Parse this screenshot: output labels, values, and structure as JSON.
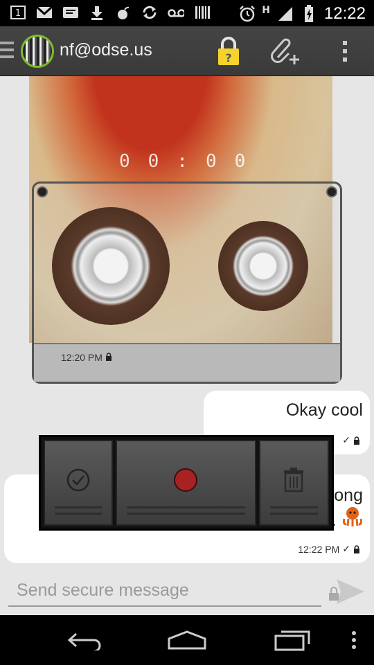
{
  "status_bar": {
    "time": "12:22",
    "network_label": "H",
    "notification_icons": [
      "sim-1-icon",
      "gmail-icon",
      "message-icon",
      "download-icon",
      "bomb-icon",
      "sync-icon",
      "voicemail-icon",
      "barcode-icon"
    ],
    "sim_label": "1"
  },
  "header": {
    "account": "nf@odse.us",
    "lock_badge": "?"
  },
  "media_message": {
    "timer": "00:00",
    "time": "12:20 PM"
  },
  "messages": [
    {
      "text": "Okay cool",
      "time": "",
      "side": "right"
    },
    {
      "text": "ong",
      "suffix": ".",
      "time": "12:22 PM",
      "side": "right"
    }
  ],
  "recorder": {
    "buttons": [
      "confirm",
      "record",
      "delete"
    ]
  },
  "composer": {
    "placeholder": "Send secure message"
  },
  "colors": {
    "avatar_ring": "#7bbd2a",
    "record_red": "#a82222",
    "lock_yellow": "#f6d22c"
  }
}
